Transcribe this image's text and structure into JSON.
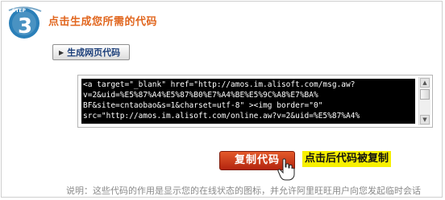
{
  "step": {
    "badge_word": "STEP",
    "badge_number": "3",
    "title": "点击生成您所需的代码"
  },
  "generate_button": {
    "label": "生成网页代码"
  },
  "code_box": {
    "text": "<a target=\"_blank\" href=\"http://amos.im.alisoft.com/msg.aw?\nv=2&uid=%E5%87%A4%E5%87%B0%E7%A4%BE%E5%9C%A8%E7%BA%\nBF&site=cntaobao&s=1&charset=utf-8\" ><img border=\"0\"\nsrc=\"http://amos.im.alisoft.com/online.aw?v=2&uid=%E5%87%A4%"
  },
  "copy_button": {
    "label": "复制代码"
  },
  "hint": "点击后代码被复制",
  "note": "说明：这些代码的作用是显示您的在线状态的图标，并允许阿里旺旺用户向您发起临时会话",
  "colors": {
    "title_orange": "#e1661e",
    "badge_blue": "#2a7fb8",
    "copy_red": "#c8371a",
    "hint_yellow": "#f7f000"
  },
  "icons": {
    "step": "step-3-badge",
    "arrow": "triangle-right-icon",
    "cursor": "hand-pointer-icon"
  }
}
